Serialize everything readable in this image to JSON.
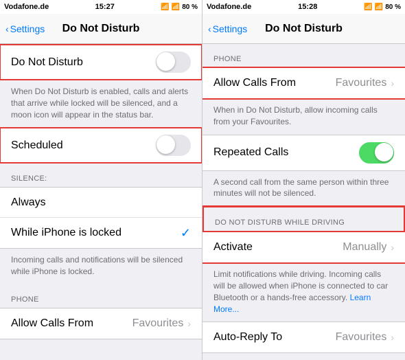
{
  "panel1": {
    "statusBar": {
      "carrier": "Vodafone.de",
      "time": "15:27",
      "wifi": "▲",
      "bluetooth": "8",
      "battery": "80 %"
    },
    "navBack": "Settings",
    "navTitle": "Do Not Disturb",
    "rows": {
      "doNotDisturb": "Do Not Disturb",
      "doNotDisturbDesc": "When Do Not Disturb is enabled, calls and alerts that arrive while locked will be silenced, and a moon icon will appear in the status bar.",
      "scheduled": "Scheduled",
      "silenceHeader": "SILENCE:",
      "always": "Always",
      "whileLocked": "While iPhone is locked",
      "whileLockedDesc": "Incoming calls and notifications will be silenced while iPhone is locked.",
      "phoneHeader": "PHONE",
      "allowCallsFrom": "Allow Calls From",
      "allowCallsValue": "Favourites"
    }
  },
  "panel2": {
    "statusBar": {
      "carrier": "Vodafone.de",
      "time": "15:28",
      "wifi": "▲",
      "bluetooth": "8",
      "battery": "80 %"
    },
    "navBack": "Settings",
    "navTitle": "Do Not Disturb",
    "rows": {
      "phoneHeader": "PHONE",
      "allowCallsFrom": "Allow Calls From",
      "allowCallsValue": "Favourites",
      "allowCallsDesc": "When in Do Not Disturb, allow incoming calls from your Favourites.",
      "repeatedCalls": "Repeated Calls",
      "repeatedCallsDesc": "A second call from the same person within three minutes will not be silenced.",
      "dndDrivingHeader": "DO NOT DISTURB WHILE DRIVING",
      "activate": "Activate",
      "activateValue": "Manually",
      "activateDesc1": "Limit notifications while driving. Incoming calls will be allowed when iPhone is connected to car Bluetooth or a hands-free accessory.",
      "activateDescLink": "Learn More...",
      "autoReplyTo": "Auto-Reply To",
      "autoReplyValue": "Favourites"
    }
  }
}
